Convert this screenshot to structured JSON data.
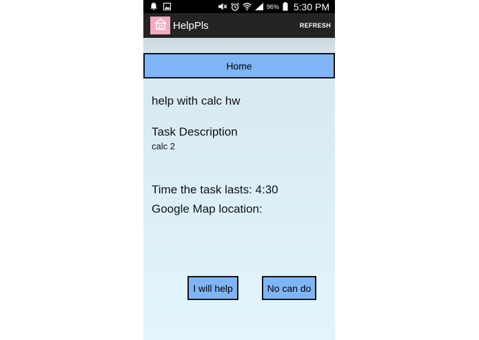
{
  "status_bar": {
    "battery_percent": "96%",
    "time": "5:30 PM",
    "icons": [
      "notification-icon",
      "image-notification-icon",
      "mute-icon",
      "alarm-icon",
      "wifi-icon",
      "signal-icon",
      "battery-icon"
    ]
  },
  "action_bar": {
    "title": "HelpPls",
    "refresh_label": "REFRESH",
    "logo_icon": "house-icon",
    "logo_color": "#f4a9bf",
    "bar_color": "#232323"
  },
  "nav": {
    "home_label": "Home",
    "button_color": "#7fb5f4"
  },
  "task": {
    "title": "help with calc hw",
    "description_heading": "Task Description",
    "description": "calc 2",
    "duration_text": "Time the task lasts: 4:30",
    "map_label": "Google Map location:"
  },
  "actions": {
    "help_label": "I will help",
    "decline_label": "No can do"
  }
}
